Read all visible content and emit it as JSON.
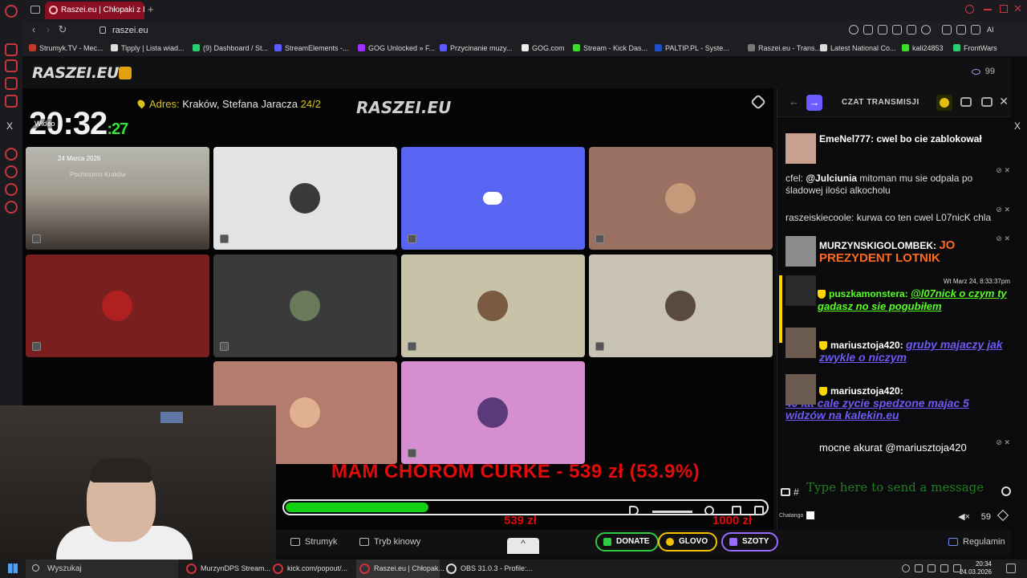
{
  "browser": {
    "tabs": [
      {
        "label": "Raszei.eu | Chłopaki z Ras"
      }
    ],
    "new_tab": "+",
    "url": "raszei.eu",
    "ai_label": "AI",
    "bookmarks": [
      {
        "label": "Strumyk.TV - Mec...",
        "color": "#c0392b"
      },
      {
        "label": "Tipply | Lista wiad...",
        "color": "#dddddd"
      },
      {
        "label": "(9) Dashboard / St...",
        "color": "#2ecc71"
      },
      {
        "label": "StreamElements -...",
        "color": "#5b5bff"
      },
      {
        "label": "GOG Unlocked » F...",
        "color": "#9b30ff"
      },
      {
        "label": "Przycinanie muzy...",
        "color": "#5b5bff"
      },
      {
        "label": "GOG.com",
        "color": "#eeeeee"
      },
      {
        "label": "Stream - Kick Das...",
        "color": "#3bdc2b"
      },
      {
        "label": "PALTIP.PL - Syste...",
        "color": "#1e50c8"
      },
      {
        "label": "Raszei.eu - Trans...",
        "color": "#777777"
      },
      {
        "label": "Latest National Co...",
        "color": "#dddddd"
      },
      {
        "label": "kali24853",
        "color": "#3bdc2b"
      },
      {
        "label": "FrontWars",
        "color": "#2ecc71"
      }
    ]
  },
  "site": {
    "logo": "RASZEI.EU",
    "viewers": "99"
  },
  "player": {
    "time_hm": "20:32",
    "time_sec": ":27",
    "live_label": "Wideo",
    "address_label": "Adres:",
    "address_text": "Kraków, Stefana Jaracza",
    "address_num": "24/2",
    "overlay_logo": "RASZEI.EU",
    "cam_date": "24 Marca 2026",
    "cam_loc": "Pochmurno   Kraków",
    "tiles": [
      {
        "bg": "#b0ada6"
      },
      {
        "bg": "#e3e3e3"
      },
      {
        "bg": "#5865f2"
      },
      {
        "bg": "#9a7062"
      },
      {
        "bg": "#7a1f1f"
      },
      {
        "bg": "#3a3a3a"
      },
      {
        "bg": "#c7c2a8"
      },
      {
        "bg": "#c9c3b4"
      },
      {
        "bg": "#b47c6e"
      },
      {
        "bg": "#d58fd0"
      }
    ],
    "donation_goal": "MAM CHOROM CURKE - 539 zł (53.9%)",
    "progress_value": 0.539,
    "progress_current": "539 zł",
    "progress_target": "1000 zł"
  },
  "chat": {
    "title": "CZAT TRANSMISJI",
    "messages": [
      {
        "user": "EmeNel777:",
        "text": "cwel bo cie zablokował"
      },
      {
        "user": "cfel:",
        "mention": "@Julciunia",
        "text": "mitoman mu sie odpala po śladowej ilości alkocholu"
      },
      {
        "user": "raszeiskiecoole:",
        "text": "kurwa co ten cwel L07nicK chla"
      },
      {
        "user": "MURZYNSKIGOLOMBEK:",
        "text": "JO PREZYDENT LOTNIK"
      },
      {
        "user": "puszkamonstera:",
        "timestamp": "Wt Marz 24, 8:33:37pm",
        "text": "@l07nick o czym ty gadasz no sie pogubiłem"
      },
      {
        "user": "mariusztoja420:",
        "text": "gruby majaczy jak zwykle o niczym"
      },
      {
        "user": "mariusztoja420:",
        "text": "40 lat cale zycie spedzone majac 5 widzów na kalekin.eu"
      },
      {
        "user": "",
        "text": "mocne akurat @mariusztoja420"
      }
    ],
    "input_placeholder": "Type here to send a message",
    "brand": "Chatango",
    "user_count": "59"
  },
  "bottom": {
    "strumyk": "Strumyk",
    "cinema": "Tryb kinowy",
    "donate": "DONATE",
    "glovo": "GLOVO",
    "szoty": "SZOTY",
    "rules": "Regulamin"
  },
  "taskbar": {
    "search": "Wyszukaj",
    "tasks": [
      "MurzynDPS Stream...",
      "kick.com/popout/...",
      "Raszei.eu | Chłopak...",
      "OBS 31.0.3 - Profile:..."
    ],
    "time": "20:34",
    "date": "24.03.2026"
  }
}
